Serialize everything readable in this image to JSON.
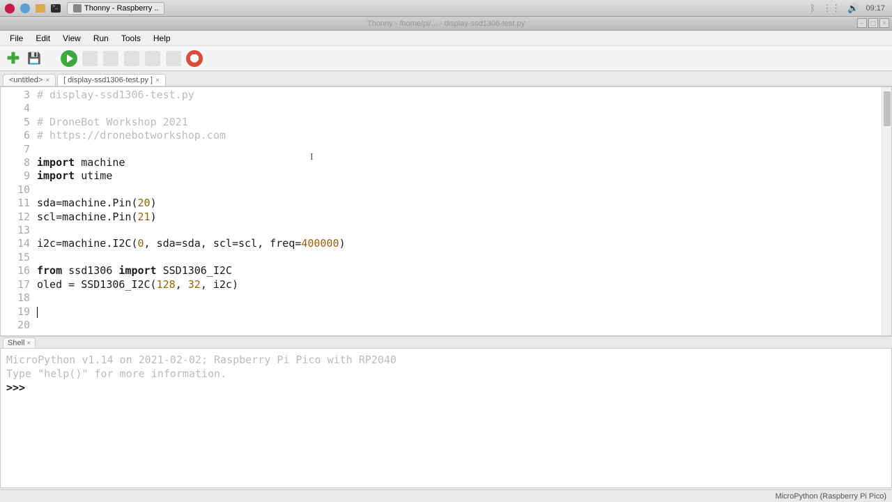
{
  "taskbar": {
    "app_label": "Thonny - Raspberry ..",
    "clock": "09:17"
  },
  "window": {
    "title": "Thonny - /home/pi/... - display-ssd1306-test.py"
  },
  "menu": {
    "items": [
      "File",
      "Edit",
      "View",
      "Run",
      "Tools",
      "Help"
    ]
  },
  "tabs": {
    "untitled": "<untitled>",
    "file": "[ display-ssd1306-test.py ]",
    "close_glyph": "×"
  },
  "code": {
    "line_start": 3,
    "lines": [
      {
        "n": 3,
        "type": "comment",
        "text": "# display-ssd1306-test.py"
      },
      {
        "n": 4,
        "type": "blank",
        "text": ""
      },
      {
        "n": 5,
        "type": "comment",
        "text": "# DroneBot Workshop 2021"
      },
      {
        "n": 6,
        "type": "comment",
        "text": "# https://dronebotworkshop.com"
      },
      {
        "n": 7,
        "type": "blank",
        "text": ""
      },
      {
        "n": 8,
        "type": "import",
        "kw": "import",
        "rest": " machine"
      },
      {
        "n": 9,
        "type": "import",
        "kw": "import",
        "rest": " utime"
      },
      {
        "n": 10,
        "type": "blank",
        "text": ""
      },
      {
        "n": 11,
        "type": "pin",
        "pre": "sda=machine.Pin(",
        "num": "20",
        "post": ")"
      },
      {
        "n": 12,
        "type": "pin",
        "pre": "scl=machine.Pin(",
        "num": "21",
        "post": ")"
      },
      {
        "n": 13,
        "type": "blank",
        "text": ""
      },
      {
        "n": 14,
        "type": "i2c"
      },
      {
        "n": 15,
        "type": "blank",
        "text": ""
      },
      {
        "n": 16,
        "type": "fromimport"
      },
      {
        "n": 17,
        "type": "oled"
      },
      {
        "n": 18,
        "type": "blank",
        "text": ""
      },
      {
        "n": 19,
        "type": "cursor"
      },
      {
        "n": 20,
        "type": "blank",
        "text": ""
      }
    ],
    "i2c_parts": {
      "pre": "i2c=machine.I2C(",
      "n0": "0",
      "mid": ", sda=sda, scl=scl, freq=",
      "n1": "400000",
      "post": ")"
    },
    "from_parts": {
      "kw1": "from",
      "mod": " ssd1306 ",
      "kw2": "import",
      "cls": " SSD1306_I2C"
    },
    "oled_parts": {
      "pre": "oled = SSD1306_I2C(",
      "n0": "128",
      "c0": ", ",
      "n1": "32",
      "c1": ", i2c)"
    }
  },
  "shell": {
    "tab_label": "Shell",
    "banner1": "MicroPython v1.14 on 2021-02-02; Raspberry Pi Pico with RP2040",
    "banner2": "Type \"help()\" for more information.",
    "prompt": ">>> "
  },
  "status": {
    "backend": "MicroPython (Raspberry Pi Pico)"
  }
}
